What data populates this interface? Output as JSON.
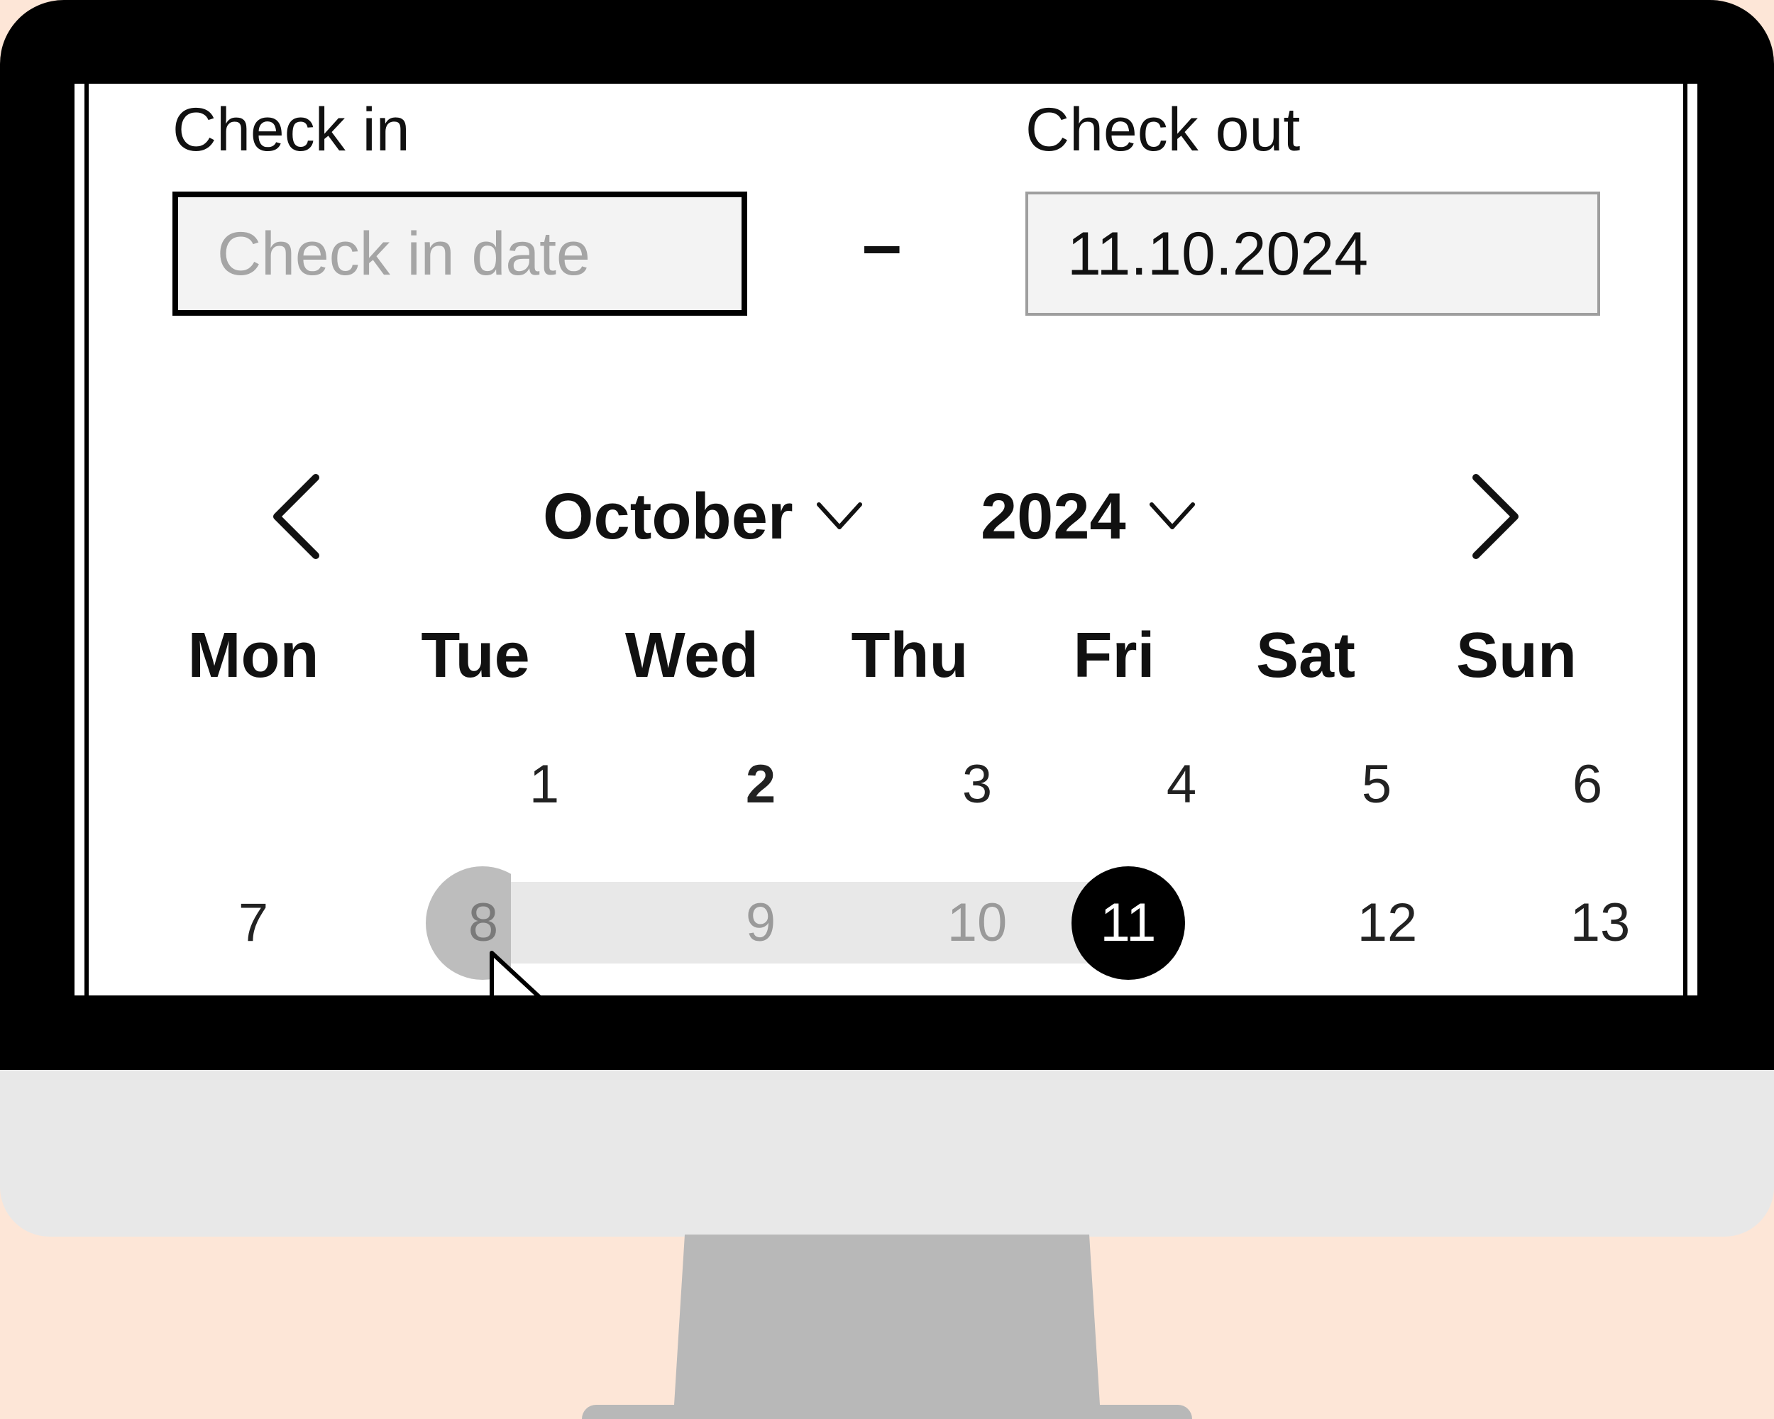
{
  "checkin": {
    "label": "Check in",
    "placeholder": "Check in date",
    "value": ""
  },
  "separator": "–",
  "checkout": {
    "label": "Check out",
    "value": "11.10.2024"
  },
  "calendar": {
    "prev_icon": "chevron-left-icon",
    "next_icon": "chevron-right-icon",
    "month": "October",
    "year": "2024",
    "weekdays": [
      "Mon",
      "Tue",
      "Wed",
      "Thu",
      "Fri",
      "Sat",
      "Sun"
    ],
    "week1": [
      "",
      "1",
      "2",
      "3",
      "4",
      "5",
      "6"
    ],
    "week2": [
      "7",
      "8",
      "9",
      "10",
      "11",
      "12",
      "13"
    ],
    "today": "2",
    "range_start": "8",
    "range_end": "11"
  },
  "colors": {
    "background": "#FDE6D7",
    "bezel": "#000000",
    "chin": "#E8E8E8",
    "stand": "#B8B8B8",
    "range_band": "#E8E8E8",
    "range_start": "#BDBDBD",
    "range_end": "#000000"
  }
}
